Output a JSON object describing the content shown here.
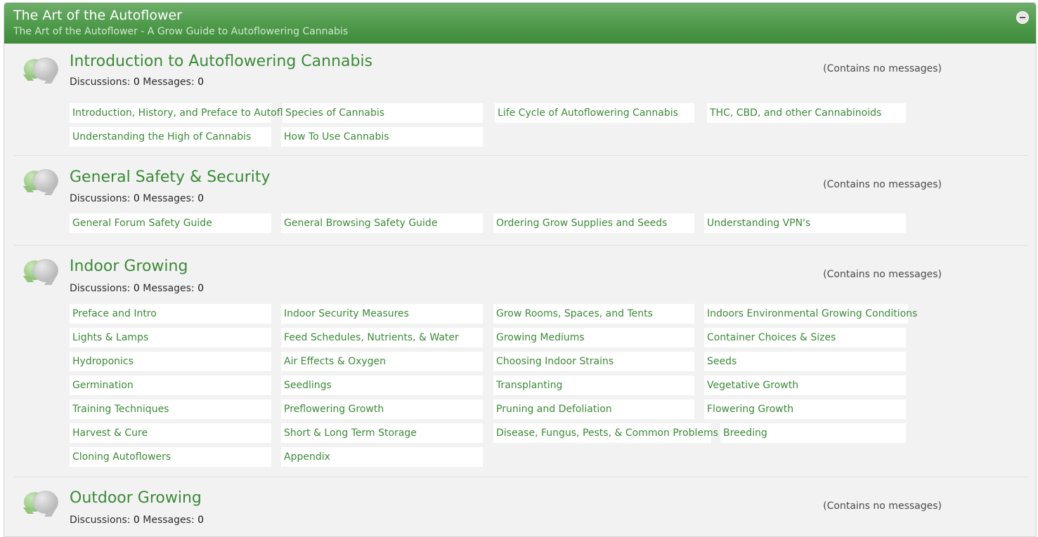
{
  "category": {
    "title": "The Art of the Autoflower",
    "description": "The Art of the Autoflower - A Grow Guide to Autoflowering Cannabis"
  },
  "labels": {
    "discussions": "Discussions:",
    "messages": "Messages:",
    "no_messages": "(Contains no messages)"
  },
  "forums": [
    {
      "title": "Introduction to Autoflowering Cannabis",
      "discussions": "0",
      "messages": "0",
      "subforums": [
        "Introduction, History, and Preface to Autoflowers",
        "Species of Cannabis",
        "Life Cycle of Autoflowering Cannabis",
        "THC, CBD, and other Cannabinoids",
        "Understanding the High of Cannabis",
        "How To Use Cannabis"
      ]
    },
    {
      "title": "General Safety & Security",
      "discussions": "0",
      "messages": "0",
      "subforums": [
        "General Forum Safety Guide",
        "General Browsing Safety Guide",
        "Ordering Grow Supplies and Seeds",
        "Understanding VPN's"
      ]
    },
    {
      "title": "Indoor Growing",
      "discussions": "0",
      "messages": "0",
      "subforums": [
        "Preface and Intro",
        "Indoor Security Measures",
        "Grow Rooms, Spaces, and Tents",
        "Indoors Environmental Growing Conditions",
        "Lights & Lamps",
        "Feed Schedules, Nutrients, & Water",
        "Growing Mediums",
        "Container Choices & Sizes",
        "Hydroponics",
        "Air Effects & Oxygen",
        "Choosing Indoor Strains",
        "Seeds",
        "Germination",
        "Seedlings",
        "Transplanting",
        "Vegetative Growth",
        "Training Techniques",
        "Preflowering Growth",
        "Pruning and Defoliation",
        "Flowering Growth",
        "Harvest & Cure",
        "Short & Long Term Storage",
        "Disease, Fungus, Pests, & Common Problems",
        "Breeding",
        "Cloning Autoflowers",
        "Appendix"
      ]
    },
    {
      "title": "Outdoor Growing",
      "discussions": "0",
      "messages": "0",
      "subforums": []
    }
  ],
  "icons": {
    "forum_icon": "chat-bubbles-icon",
    "collapse": "minus-circle-icon"
  },
  "colors": {
    "header_green": "#4f9a4b",
    "link_green": "#3b8a37",
    "panel_bg": "#f2f2f2"
  }
}
